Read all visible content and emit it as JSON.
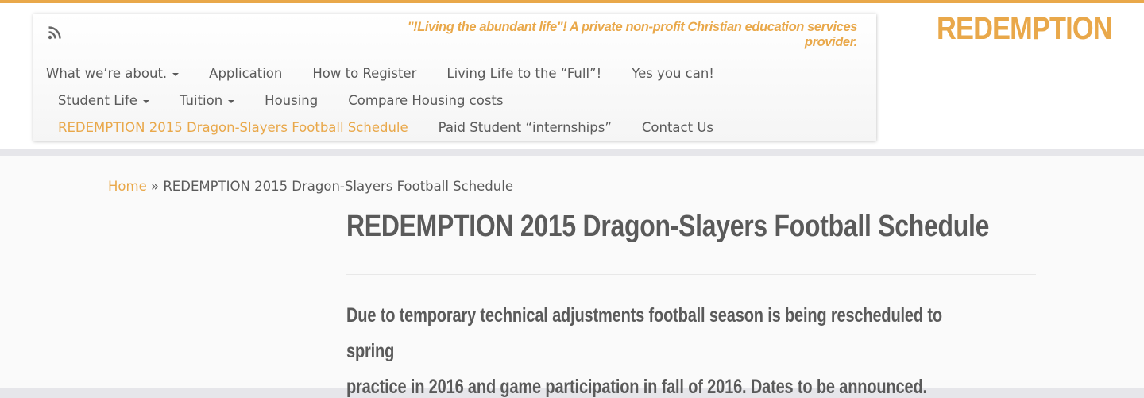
{
  "site": {
    "brand": "REDEMPTION",
    "tagline": "\"!Living the abundant life\"! A private non-profit Christian education services provider.",
    "accent_color": "#e9a84a",
    "icons": {
      "feed": "rss-icon",
      "dropdown": "caret-down-icon"
    }
  },
  "nav": {
    "row1": [
      {
        "label": "What we’re about.",
        "has_dropdown": true
      },
      {
        "label": "Application",
        "has_dropdown": false
      },
      {
        "label": "How to Register",
        "has_dropdown": false
      },
      {
        "label": "Living Life to the “Full”!",
        "has_dropdown": false
      },
      {
        "label": "Yes you can!",
        "has_dropdown": false
      }
    ],
    "row2": [
      {
        "label": "Student Life",
        "has_dropdown": true
      },
      {
        "label": "Tuition",
        "has_dropdown": true
      },
      {
        "label": "Housing",
        "has_dropdown": false
      },
      {
        "label": "Compare Housing costs",
        "has_dropdown": false
      }
    ],
    "row3": [
      {
        "label": "REDEMPTION 2015 Dragon-Slayers Football Schedule",
        "has_dropdown": false,
        "active": true
      },
      {
        "label": "Paid Student “internships”",
        "has_dropdown": false
      },
      {
        "label": "Contact Us",
        "has_dropdown": false
      }
    ]
  },
  "breadcrumb": {
    "home": "Home",
    "separator": "»",
    "current": "REDEMPTION 2015 Dragon-Slayers Football Schedule"
  },
  "page": {
    "title": "REDEMPTION 2015 Dragon-Slayers Football Schedule",
    "body_line1": "Due to temporary technical adjustments football season is being rescheduled to spring",
    "body_line2": "practice in 2016 and game participation in fall of 2016. Dates to be announced."
  }
}
